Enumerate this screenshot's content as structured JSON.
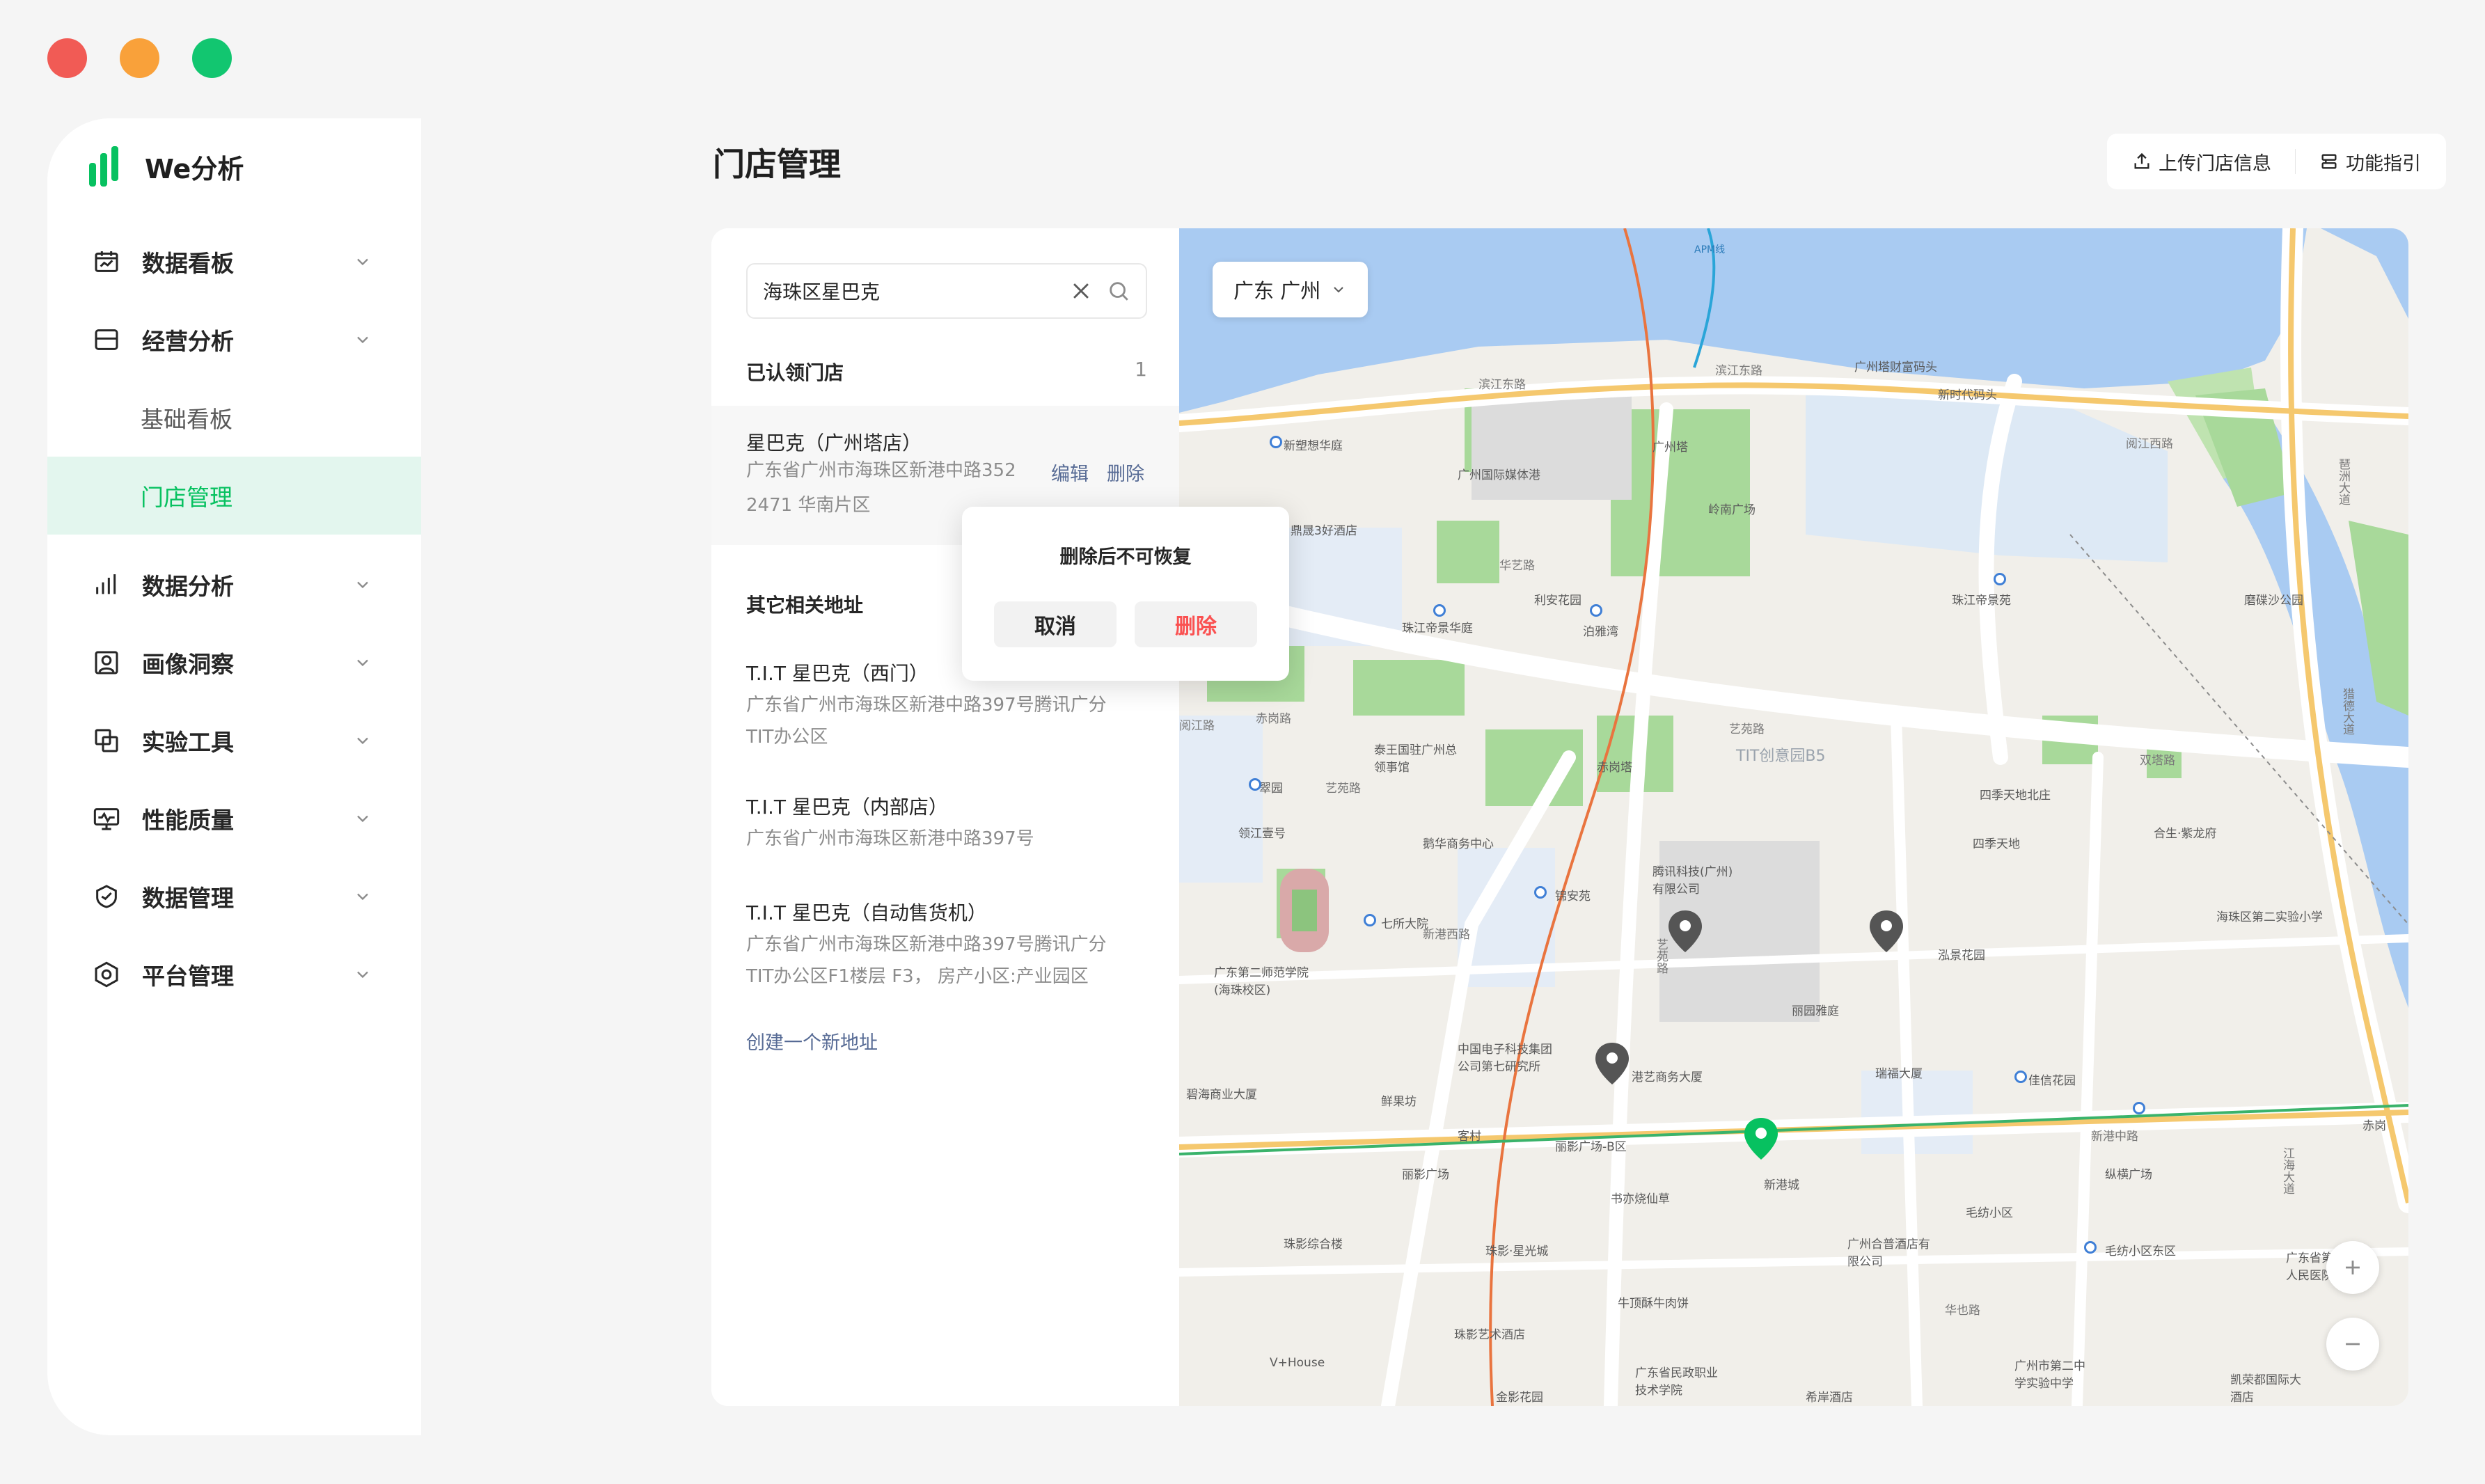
{
  "window": {
    "controls": [
      "close",
      "minimize",
      "maximize"
    ],
    "colors": [
      "#f15b55",
      "#f9a13a",
      "#12c670"
    ]
  },
  "brand": {
    "name": "We分析",
    "color": "#07c160"
  },
  "nav": {
    "items": [
      {
        "label": "数据看板",
        "icon": "calendar-board-icon"
      },
      {
        "label": "经营分析",
        "icon": "inbox-icon"
      },
      {
        "label": "数据分析",
        "icon": "bar-chart-icon"
      },
      {
        "label": "画像洞察",
        "icon": "portrait-icon"
      },
      {
        "label": "实验工具",
        "icon": "copy-icon"
      },
      {
        "label": "性能质量",
        "icon": "monitor-pulse-icon"
      },
      {
        "label": "数据管理",
        "icon": "shield-check-icon"
      },
      {
        "label": "平台管理",
        "icon": "hexagon-settings-icon"
      }
    ],
    "subitems": [
      {
        "label": "基础看板",
        "active": false
      },
      {
        "label": "门店管理",
        "active": true
      }
    ]
  },
  "header": {
    "title": "门店管理",
    "upload_label": "上传门店信息",
    "guide_label": "功能指引"
  },
  "search": {
    "value": "海珠区星巴克"
  },
  "claimed": {
    "heading": "已认领门店",
    "count": "1",
    "store": {
      "name": "星巴克（广州塔店）",
      "address": "广东省广州市海珠区新港中路352",
      "address_line2": "2471   华南片区",
      "edit_label": "编辑",
      "delete_label": "删除"
    }
  },
  "popover": {
    "message": "删除后不可恢复",
    "cancel_label": "取消",
    "confirm_label": "删除"
  },
  "related": {
    "heading": "其它相关地址",
    "items": [
      {
        "name": "T.I.T 星巴克（西门）",
        "address_lines": [
          "广东省广州市海珠区新港中路397号腾讯广分",
          "TIT办公区"
        ]
      },
      {
        "name": "T.I.T 星巴克（内部店）",
        "address_lines": [
          "广东省广州市海珠区新港中路397号"
        ]
      },
      {
        "name": "T.I.T 星巴克（自动售货机）",
        "address_lines": [
          "广东省广州市海珠区新港中路397号腾讯广分",
          "TIT办公区F1楼层 F3， 房产小区:产业园区"
        ]
      }
    ],
    "create_label": "创建一个新地址"
  },
  "map": {
    "city": "广东 广州",
    "labels": {
      "l1": "滨江东路",
      "l2": "滨江东路",
      "l3": "广州塔财富码头",
      "l4": "新时代码头",
      "l5": "阅江西路",
      "l6": "新塑想华庭",
      "l7": "广州国际媒体港",
      "l8": "广州塔",
      "l9": "岭南广场",
      "l10": "珠江帝景华庭",
      "l11": "利安花园",
      "l12": "泊雅湾",
      "l13": "珠江帝景苑",
      "l14": "磨碟沙公园",
      "l15": "艺苑路",
      "l16": "TIT创意园B5",
      "l17": "四季天地北庄",
      "l18": "双塔路",
      "l19": "腾讯科技(广州)有限公司",
      "l20": "泓景花园",
      "l21": "丽园雅庭",
      "l22": "瑞福大厦",
      "l23": "佳信花园",
      "l24": "新港中路",
      "l25": "赤岗",
      "l26": "新港城",
      "l27": "丽影广场-B区",
      "l28": "书亦烧仙草",
      "l29": "珠影综合楼",
      "l30": "珠影·星光城",
      "l31": "牛顶酥牛肉饼",
      "l32": "珠影艺术酒店",
      "l33": "广州合普酒店有限公司",
      "l34": "毛纺小区",
      "l35": "毛纺小区东区",
      "l36": "华也路",
      "l37": "V+House",
      "l38": "金影花园",
      "l39": "广东省民政职业技术学院",
      "l40": "希岸酒店",
      "l41": "凯荣都国际大酒店",
      "l42": "海珠区第二实验小学",
      "l43": "七所大院",
      "l44": "锦安苑",
      "l45": "中国电子科技集团公司第七研究所",
      "l46": "港艺商务大厦",
      "l47": "碧海商业大厦",
      "l48": "鲜果坊",
      "l49": "客村",
      "l50": "丽影广场",
      "l51": "赤岗塔",
      "l52": "艺苑路",
      "l53": "鹅华商务中心",
      "l54": "琶洲大道",
      "l55": "猎德大道",
      "l56": "江海大道",
      "l57": "新港西路",
      "l58": "APM线",
      "l59": "阅江路",
      "l60": "四季天地",
      "l61": "合生·紫龙府",
      "l62": "纵横广场",
      "l63": "赤岗路",
      "l64": "艺苑路",
      "l65": "华艺路",
      "l66": "广东省第二人民医院",
      "l67": "广州市第二中学实验中学",
      "l68": "广东第二师范学院(海珠校区)",
      "l69": "领江壹号",
      "l70": "翠园",
      "l71": "鼎晟3好酒店",
      "l72": "泰王国驻广州总领事馆"
    }
  }
}
